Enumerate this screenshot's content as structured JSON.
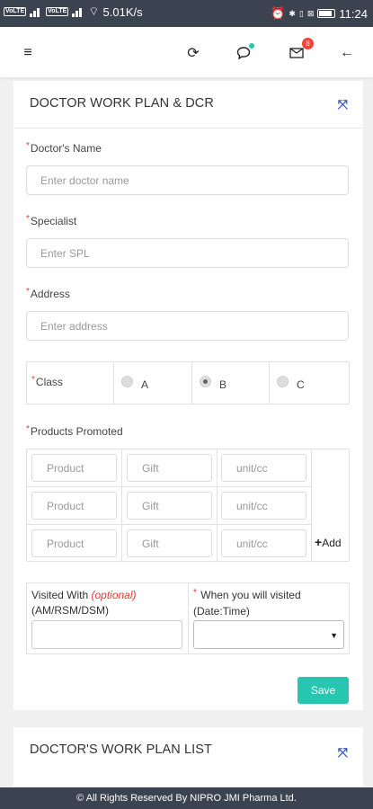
{
  "status_bar": {
    "volte1": "VoLTE",
    "volte2": "VoLTE",
    "speed": "5.01K/s",
    "time": "11:24",
    "icons": [
      "signal-icon",
      "signal-icon",
      "wifi-icon",
      "alarm-icon",
      "bluetooth-icon",
      "vibrate-icon",
      "no-sim-icon",
      "battery-icon"
    ]
  },
  "app_bar": {
    "icons": [
      "menu-icon",
      "refresh-icon",
      "chat-icon",
      "mail-icon",
      "back-arrow-icon"
    ],
    "mail_badge": "8"
  },
  "form": {
    "title": "DOCTOR WORK PLAN & DCR",
    "doctor_name": {
      "label": "Doctor's Name",
      "placeholder": "Enter doctor name",
      "value": ""
    },
    "specialist": {
      "label": "Specialist",
      "placeholder": "Enter SPL",
      "value": ""
    },
    "address": {
      "label": "Address",
      "placeholder": "Enter address",
      "value": ""
    },
    "class": {
      "label": "Class",
      "options": [
        "A",
        "B",
        "C"
      ],
      "selected": "B"
    },
    "products": {
      "label": "Products Promoted",
      "rows": [
        {
          "product": "Product",
          "gift": "Gift",
          "unit": "unit/cc"
        },
        {
          "product": "Product",
          "gift": "Gift",
          "unit": "unit/cc"
        },
        {
          "product": "Product",
          "gift": "Gift",
          "unit": "unit/cc"
        }
      ],
      "add_label": "Add",
      "add_symbol": "+"
    },
    "visited_with": {
      "label": "Visited With",
      "optional": "(optional)",
      "sub_label": "(AM/RSM/DSM)",
      "value": ""
    },
    "when_visited": {
      "label": "When you will visited",
      "sub_label": "(Date:Time)",
      "value": ""
    },
    "required_mark": "*",
    "save_label": "Save"
  },
  "list": {
    "title": "DOCTOR'S WORK PLAN LIST"
  },
  "footer": {
    "text": "© All Rights Reserved By NIPRO JMI Pharma Ltd."
  },
  "colors": {
    "status_bar": "#3b4250",
    "accent": "#26c6b0",
    "required": "#e53935",
    "expand_icon": "#3b5fc0"
  }
}
